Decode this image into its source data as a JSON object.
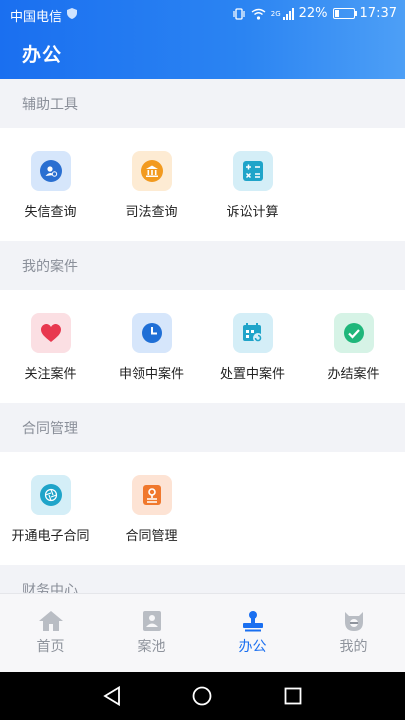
{
  "status_bar": {
    "carrier": "中国电信",
    "battery": "22%",
    "time": "17:37",
    "network": "2G"
  },
  "header": {
    "title": "办公"
  },
  "sections": [
    {
      "label": "辅助工具",
      "items": [
        {
          "label": "失信查询",
          "icon": "dishonesty-search-icon"
        },
        {
          "label": "司法查询",
          "icon": "court-building-icon"
        },
        {
          "label": "诉讼计算",
          "icon": "calculator-icon"
        }
      ]
    },
    {
      "label": "我的案件",
      "items": [
        {
          "label": "关注案件",
          "icon": "heart-icon"
        },
        {
          "label": "申领中案件",
          "icon": "clock-icon"
        },
        {
          "label": "处置中案件",
          "icon": "calendar-refresh-icon"
        },
        {
          "label": "办结案件",
          "icon": "check-circle-icon"
        }
      ]
    },
    {
      "label": "合同管理",
      "items": [
        {
          "label": "开通电子合同",
          "icon": "aperture-icon"
        },
        {
          "label": "合同管理",
          "icon": "contract-stamp-icon"
        }
      ]
    },
    {
      "label": "财务中心",
      "items": []
    }
  ],
  "bottom_nav": [
    {
      "label": "首页",
      "icon": "home-icon",
      "active": false
    },
    {
      "label": "案池",
      "icon": "case-pool-icon",
      "active": false
    },
    {
      "label": "办公",
      "icon": "office-stamp-icon",
      "active": true
    },
    {
      "label": "我的",
      "icon": "profile-icon",
      "active": false
    }
  ],
  "colors": {
    "accent": "#1a6ff0",
    "header_gradient_end": "#4d9ff6"
  }
}
